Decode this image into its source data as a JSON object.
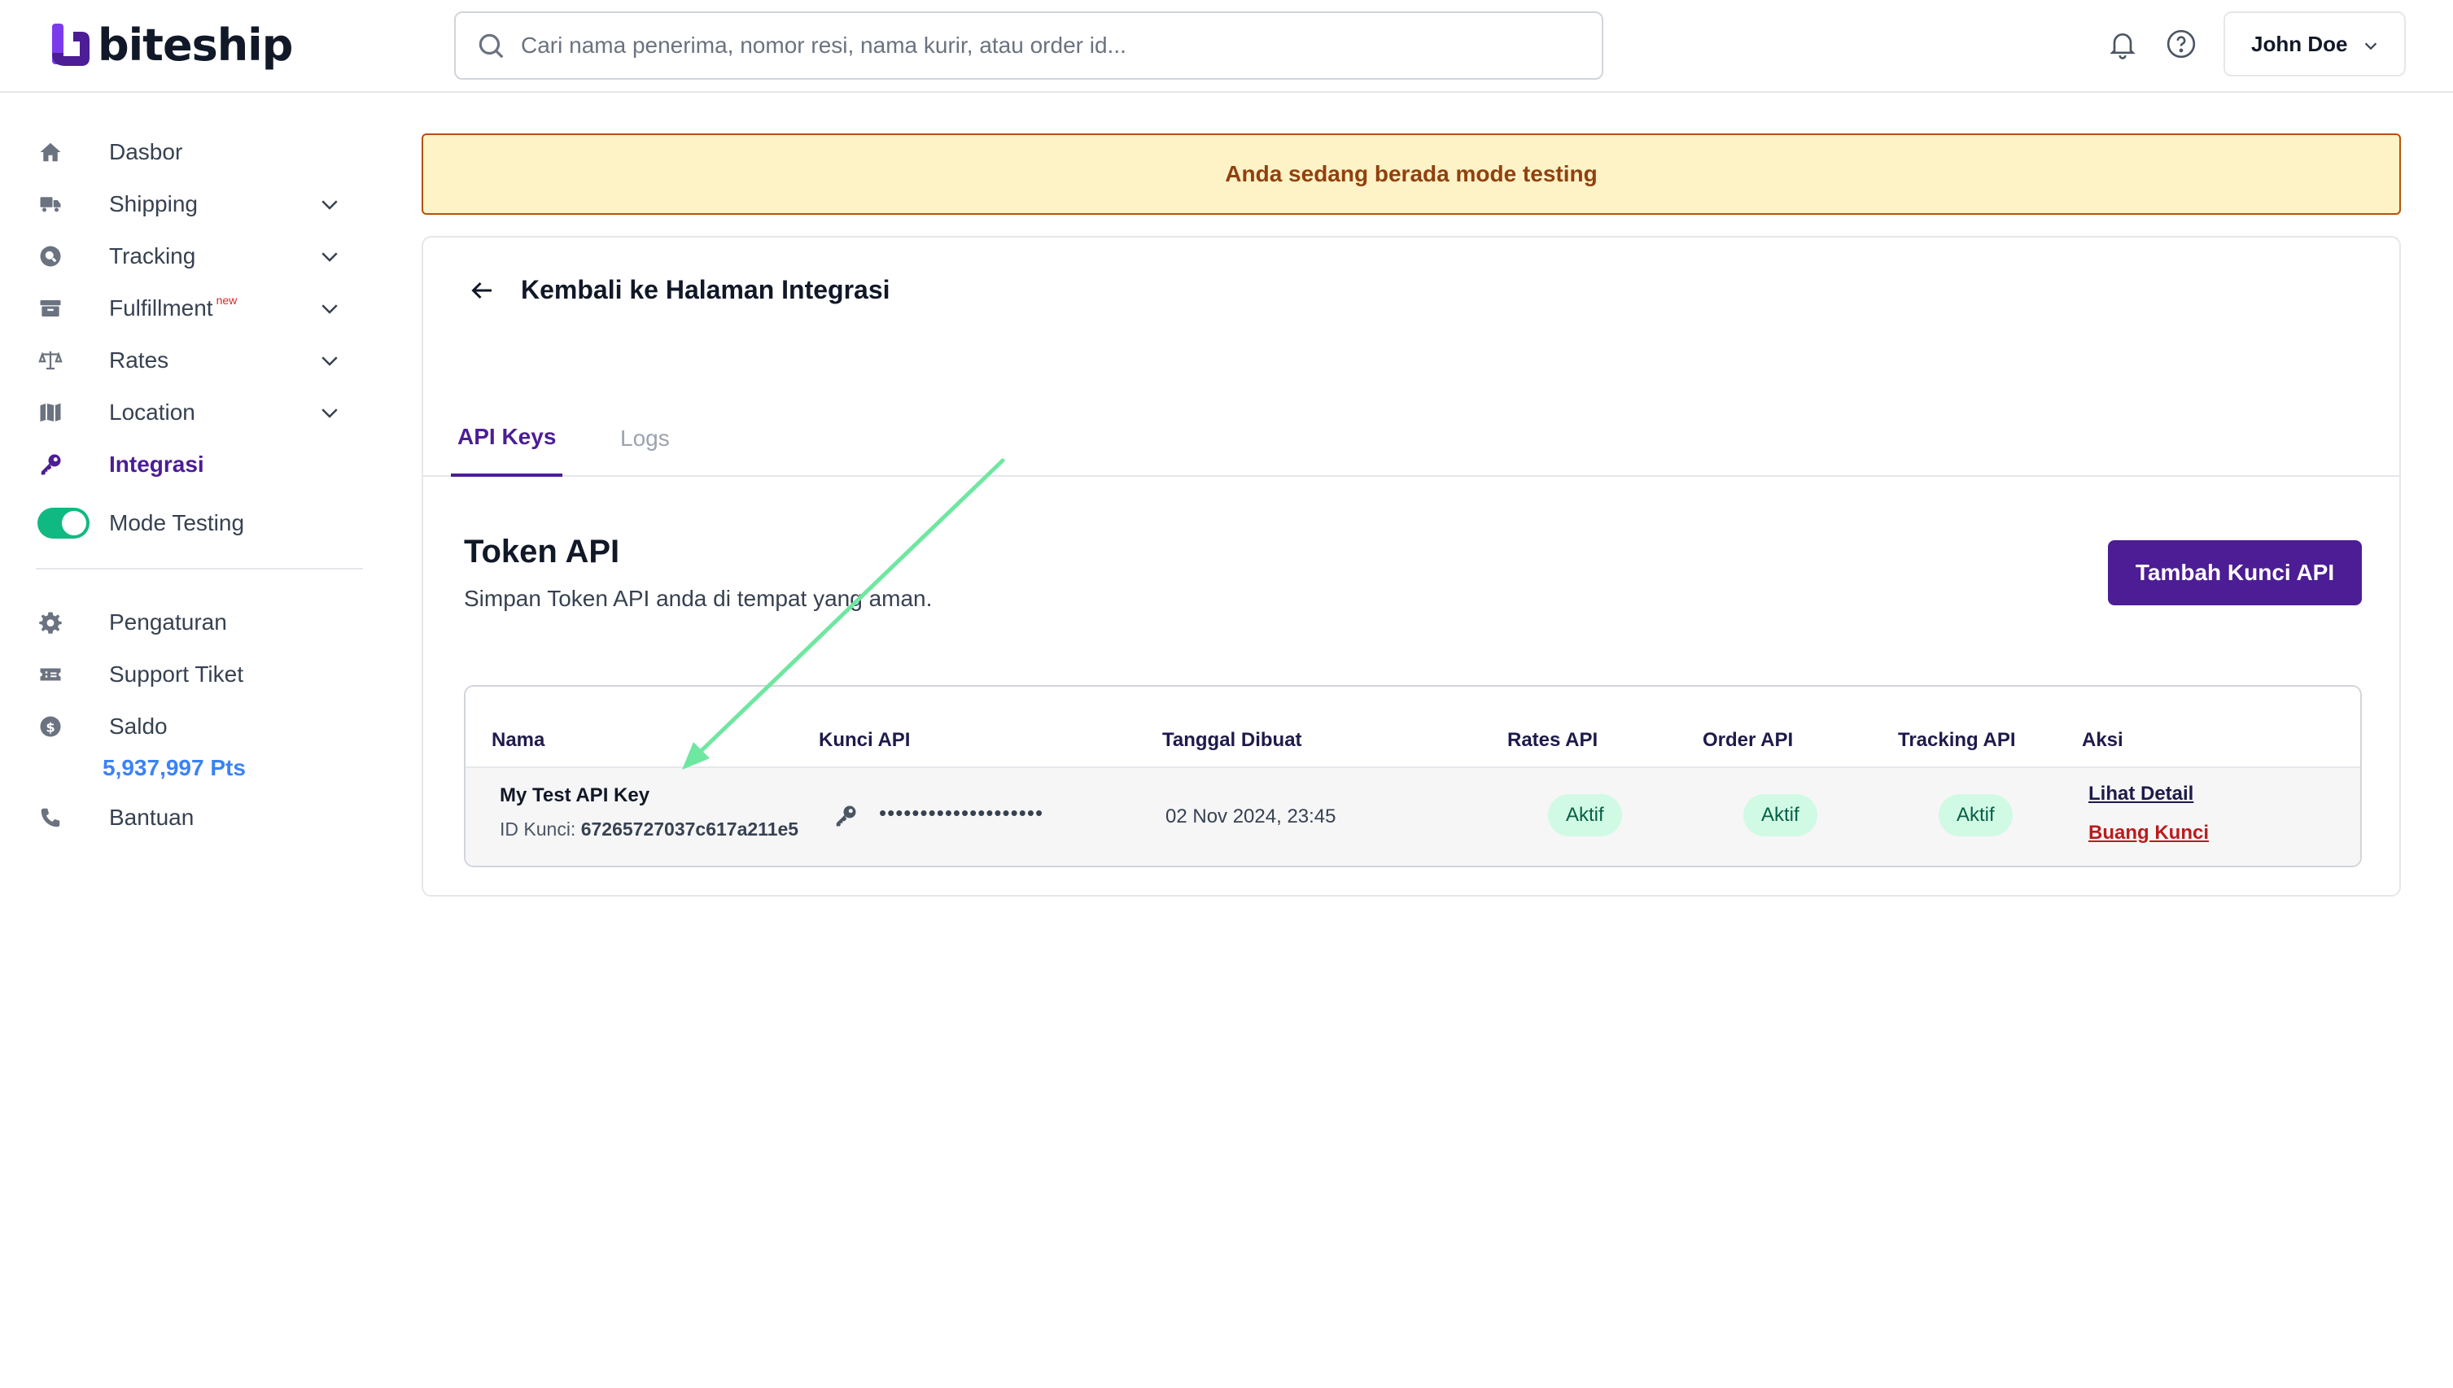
{
  "header": {
    "logo_text": "biteship",
    "search_placeholder": "Cari nama penerima, nomor resi, nama kurir, atau order id...",
    "user_name": "John Doe"
  },
  "sidebar": {
    "items": [
      {
        "label": "Dasbor",
        "icon": "home-icon"
      },
      {
        "label": "Shipping",
        "icon": "truck-icon"
      },
      {
        "label": "Tracking",
        "icon": "tracking-icon"
      },
      {
        "label": "Fulfillment",
        "icon": "box-icon",
        "badge": "new"
      },
      {
        "label": "Rates",
        "icon": "scale-icon"
      },
      {
        "label": "Location",
        "icon": "map-icon"
      },
      {
        "label": "Integrasi",
        "icon": "key-icon"
      },
      {
        "label": "Mode Testing"
      }
    ],
    "secondary": [
      {
        "label": "Pengaturan",
        "icon": "gear-icon"
      },
      {
        "label": "Support Tiket",
        "icon": "ticket-icon"
      },
      {
        "label": "Saldo",
        "icon": "coin-icon"
      },
      {
        "label": "Bantuan",
        "icon": "phone-icon"
      }
    ],
    "balance": "5,937,997 Pts"
  },
  "banner": {
    "text": "Anda sedang berada mode testing"
  },
  "page": {
    "back_label": "Kembali ke Halaman Integrasi",
    "tabs": [
      {
        "label": "API Keys"
      },
      {
        "label": "Logs"
      }
    ],
    "token_title": "Token API",
    "token_subtitle": "Simpan Token API anda di tempat yang aman.",
    "add_button": "Tambah Kunci API"
  },
  "table": {
    "columns": [
      "Nama",
      "Kunci API",
      "Tanggal Dibuat",
      "Rates API",
      "Order API",
      "Tracking API",
      "Aksi"
    ],
    "rows": [
      {
        "name": "My Test API Key",
        "id_label": "ID Kunci:",
        "id_value": "67265727037c617a211e5",
        "key_mask": "••••••••••••••••••••",
        "created": "02 Nov 2024, 23:45",
        "rates": "Aktif",
        "order": "Aktif",
        "tracking": "Aktif",
        "detail_link": "Lihat Detail",
        "remove_link": "Buang Kunci"
      }
    ]
  },
  "colors": {
    "brand_purple": "#4c1d95",
    "toggle_green": "#10b981",
    "banner_bg": "#fdf3c7",
    "banner_text": "#92400e",
    "arrow_green": "#6ee7a0"
  }
}
